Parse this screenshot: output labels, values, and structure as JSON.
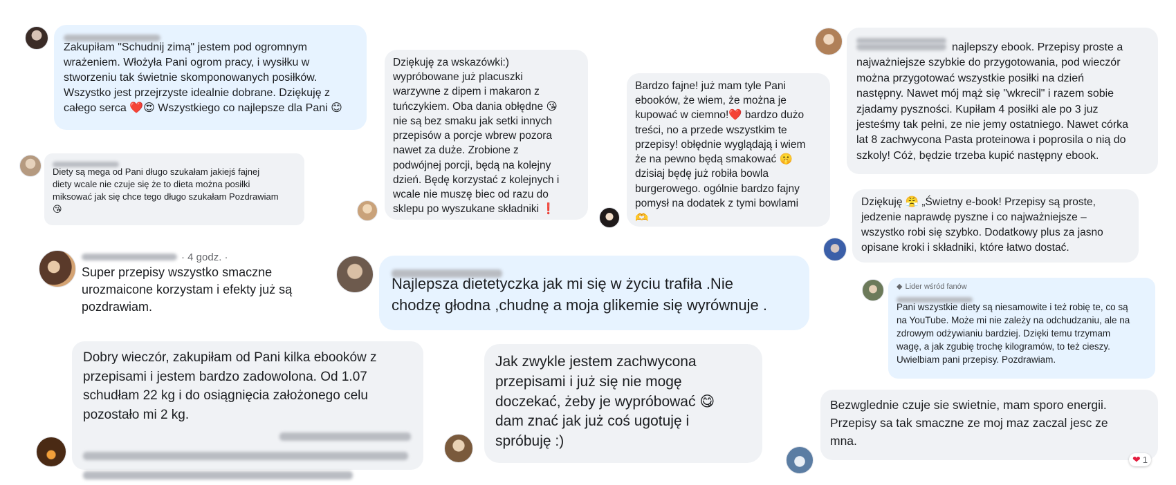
{
  "colors": {
    "bubble_gray": "#f0f2f5",
    "bubble_blue": "#e7f3ff",
    "heart_red": "#e41e3f"
  },
  "comments": [
    {
      "id": "c1",
      "text": "Zakupiłam \"Schudnij zimą\" jestem pod ogromnym\nwrażeniem. Włożyła Pani ogrom pracy, i wysiłku w\nstworzeniu tak świetnie skomponowanych posiłków.\nWszystko jest przejrzyste idealnie dobrane. Dziękuję z\ncałego serca ❤️😍 Wszystkiego co najlepsze dla Pani 😊"
    },
    {
      "id": "c2",
      "text": "Diety są mega od Pani długo szukałam jakiejś fajnej\ndiety wcale nie czuje się że to dieta można posiłki\nmiksować jak się chce tego długo szukałam Pozdrawiam\n😘"
    },
    {
      "id": "c3",
      "time": "· 4 godz. ·",
      "text": "Super przepisy wszystko smaczne\nurozmaicone korzystam i efekty już są\npozdrawiam."
    },
    {
      "id": "c4",
      "text_visible": "Dobry wieczór, zakupiłam od Pani kilka ebooków z\nprzepisami i jestem bardzo zadowolona. Od 1.07\nschudłam 22 kg i do osiągnięcia założonego celu\npozostało mi 2 kg."
    },
    {
      "id": "c5",
      "text": "Dziękuję za wskazówki:)\nwypróbowane już placuszki\nwarzywne z dipem i makaron z\ntuńczykiem. Oba dania obłędne 😘\nnie są bez smaku jak setki innych\nprzepisów a porcje wbrew pozora\nnawet za duże. Zrobione z\npodwójnej porcji, będą na kolejny\ndzień. Będę korzystać z kolejnych i\nwcale nie muszę biec od razu do\nsklepu po wyszukane składniki ❗"
    },
    {
      "id": "c6",
      "text": "Bardzo fajne! już mam tyle Pani\nebooków, że wiem, że można je\nkupować w ciemno!❤️ bardzo dużo\ntreści, no a przede wszystkim te\nprzepisy! obłędnie wyglądają i wiem\nże na pewno będą smakować 🤫\ndzisiaj będę już robiła bowla\nburgerowego. ogólnie bardzo fajny\npomysł na dodatek z tymi bowlami\n🫶"
    },
    {
      "id": "c7",
      "text": "Najlepsza dietetyczka jak mi się w życiu trafiła .Nie\nchodzę głodna ,chudnę a moja glikemie się wyrównuje ."
    },
    {
      "id": "c8",
      "text": "Jak zwykle jestem zachwycona\nprzepisami i już się nie mogę\ndoczekać, żeby je wypróbować 😋\ndam znać jak już coś ugotuję i\nspróbuję :)"
    },
    {
      "id": "c9",
      "text": "najlepszy ebook. Przepisy proste a\nnajważniejsze szybkie do przygotowania, pod wieczór\nmożna przygotować wszystkie posiłki na dzień\nnastępny. Nawet mój mąż się \"wkrecil\" i razem sobie\nzjadamy pyszności. Kupiłam 4 posiłki ale po 3 juz\njesteśmy tak pełni, ze nie jemy ostatniego. Nawet córka\nlat 8 zachwycona Pasta proteinowa i poprosila o nią do\nszkoly! Cóż, będzie trzeba kupić następny ebook."
    },
    {
      "id": "c10",
      "text": "Dziękuję 😤 „Świetny e-book! Przepisy są proste,\njedzenie naprawdę pyszne i co najważniejsze –\nwszystko robi się szybko. Dodatkowy plus za jasno\nopisane kroki i składniki, które łatwo dostać."
    },
    {
      "id": "c11",
      "badge": "Lider wśród fanów",
      "text": "Pani wszystkie diety są niesamowite i też robię te, co są\nna YouTube. Może mi nie zależy na odchudzaniu, ale na\nzdrowym odżywianiu bardziej. Dzięki temu trzymam\nwagę, a jak zgubię trochę kilogramów, to też cieszy.\nUwielbiam pani przepisy. Pozdrawiam."
    },
    {
      "id": "c12",
      "text": "Bezwglednie czuje sie swietnie, mam sporo energii.\nPrzepisy sa tak smaczne ze moj maz zaczal jesc ze\nmna.",
      "reaction_icon": "heart-icon",
      "reaction_count": "1"
    }
  ]
}
